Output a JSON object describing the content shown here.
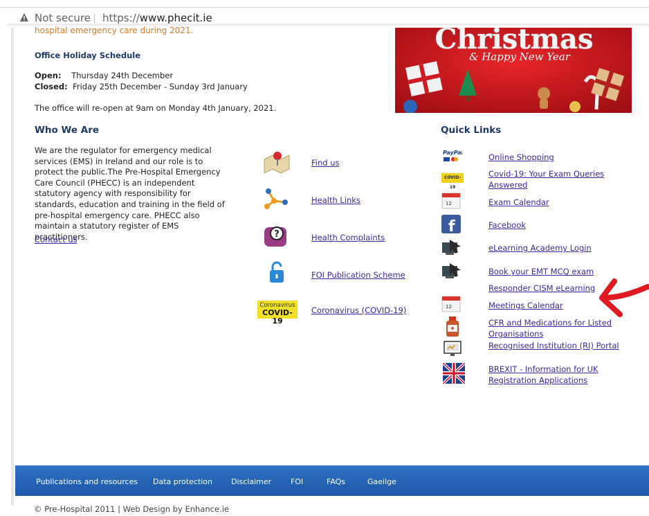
{
  "browser": {
    "not_secure": "Not secure",
    "url_prefix": "https://",
    "url_domain": "www.phecit.ie"
  },
  "notice": {
    "emergency_text": "hospital emergency care during 2021.",
    "heading": "Office Holiday Schedule",
    "open_label": "Open:",
    "open_value": "Thursday  24th December",
    "closed_label": "Closed:",
    "closed_value": "Friday 25th December - Sunday 3rd January",
    "reopen": "The office will re-open at 9am on Monday 4th January, 2021."
  },
  "banner": {
    "title": "Christmas",
    "subtitle": "& Happy New Year"
  },
  "who": {
    "heading": "Who We Are",
    "text": "We are the regulator for emergency medical services (EMS) in Ireland and our role is to protect the public.The Pre-Hospital Emergency Care Council (PHECC) is an independent statutory agency with responsibility for standards, education and training in the field of pre-hospital emergency care. PHECC also maintain a statutory register of EMS practitioners.",
    "contact": "Contact us"
  },
  "middle_links": [
    {
      "label": "Find us",
      "icon": "map-pin-icon"
    },
    {
      "label": "Health Links",
      "icon": "network-icon"
    },
    {
      "label": "Health Complaints",
      "icon": "question-bubble-icon"
    },
    {
      "label": "FOI Publication Scheme",
      "icon": "padlock-icon"
    },
    {
      "label": "Coronavirus (COVID-19)",
      "icon": "covid-badge-icon",
      "badge_top": "Coronavirus",
      "badge_bottom": "COVID-19"
    }
  ],
  "quick_links": {
    "heading": "Quick Links",
    "items": [
      {
        "label": "Online Shopping",
        "icon": "paypal-icon"
      },
      {
        "label": "Covid-19: Your Exam Queries Answered",
        "icon": "covid-icon"
      },
      {
        "label": "Exam Calendar",
        "icon": "calendar-icon"
      },
      {
        "label": "Facebook",
        "icon": "facebook-icon"
      },
      {
        "label": "eLearning Academy Login",
        "icon": "computer-arrow-icon"
      },
      {
        "label": "Book your EMT MCQ exam",
        "icon": "computer-arrow-icon"
      },
      {
        "label": "Responder CISM eLearning",
        "icon": ""
      },
      {
        "label": "Meetings Calendar",
        "icon": "calendar-icon"
      },
      {
        "label": "CFR and  Medications for Listed Organisations",
        "icon": "medicine-bottle-icon"
      },
      {
        "label": "Recognised Institution (RI) Portal",
        "icon": "monitor-icon"
      },
      {
        "label": "BREXIT - Information for UK Registration Applications",
        "icon": "uk-flag-icon"
      }
    ]
  },
  "footer": {
    "links": [
      "Publications and resources",
      "Data protection",
      "Disclaimer",
      "FOI",
      "FAQs",
      "Gaeilge"
    ]
  },
  "copyright": "© Pre-Hospital 2011 | Web Design by Enhance.ie",
  "colors": {
    "heading": "#1f3a67",
    "link": "#3a28a8",
    "footer": "#2566b5",
    "orange": "#d37c2c",
    "annotation_arrow": "#e01820"
  }
}
